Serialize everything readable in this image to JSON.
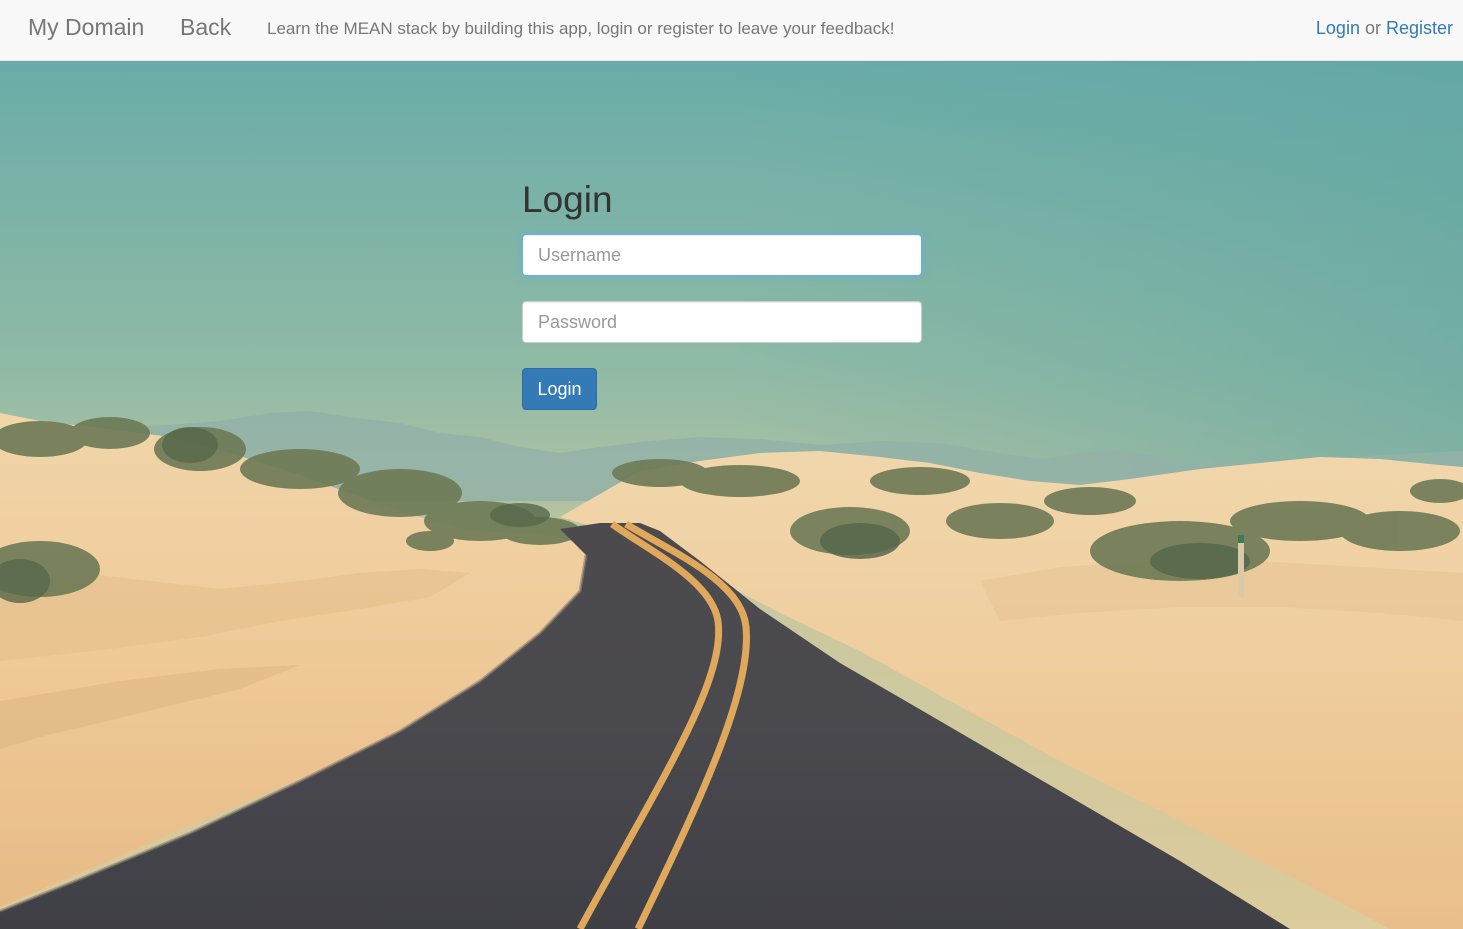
{
  "navbar": {
    "brand": "My Domain",
    "back": "Back",
    "message": "Learn the MEAN stack by building this app, login or register to leave your feedback!",
    "login_link": "Login",
    "separator": " or ",
    "register_link": "Register"
  },
  "login_form": {
    "title": "Login",
    "username_placeholder": "Username",
    "username_value": "",
    "password_placeholder": "Password",
    "password_value": "",
    "submit_label": "Login"
  },
  "background": {
    "icon": "desert-road-photo"
  },
  "colors": {
    "navbar_bg": "#f8f8f8",
    "link": "#337ab7",
    "primary_button": "#337ab7",
    "muted_text": "#777777",
    "focus_border": "#66afe9"
  }
}
